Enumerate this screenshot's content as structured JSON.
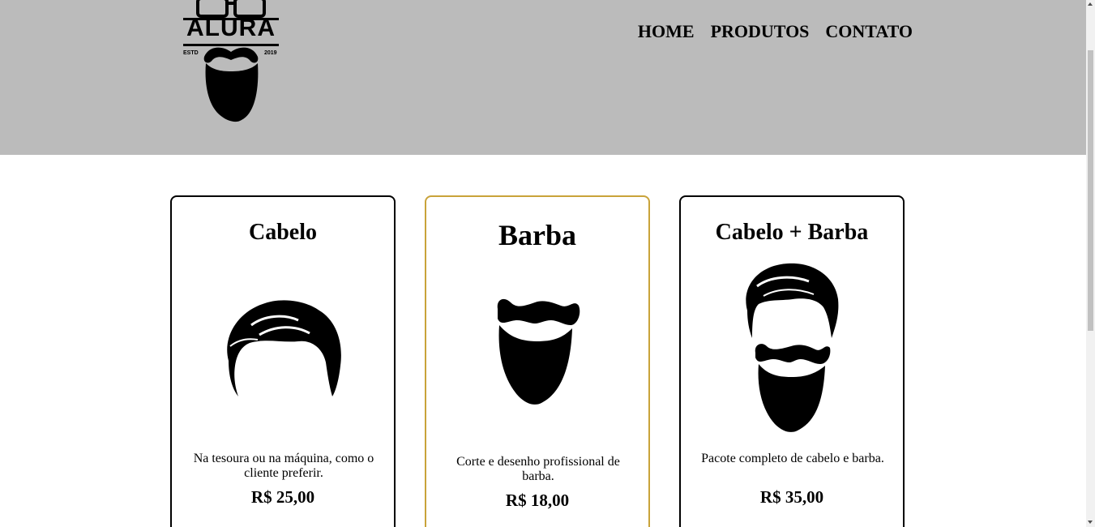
{
  "header": {
    "logo_text": "ALURA",
    "logo_estd": "ESTD",
    "logo_year": "2019",
    "background": "#bbbbbb"
  },
  "nav": {
    "items": [
      {
        "label": "HOME"
      },
      {
        "label": "PRODUTOS"
      },
      {
        "label": "CONTATO"
      }
    ]
  },
  "cards": [
    {
      "title": "Cabelo",
      "image": "hair-icon",
      "description": "Na tesoura ou na máquina, como o cliente preferir.",
      "price": "R$ 25,00"
    },
    {
      "title": "Barba",
      "image": "beard-icon",
      "description": "Corte e desenho profissional de barba.",
      "price": "R$ 18,00",
      "border_color": "#c9a33a"
    },
    {
      "title": "Cabelo + Barba",
      "image": "hair-and-beard-icon",
      "description": "Pacote completo de cabelo e barba.",
      "price": "R$ 35,00"
    }
  ]
}
